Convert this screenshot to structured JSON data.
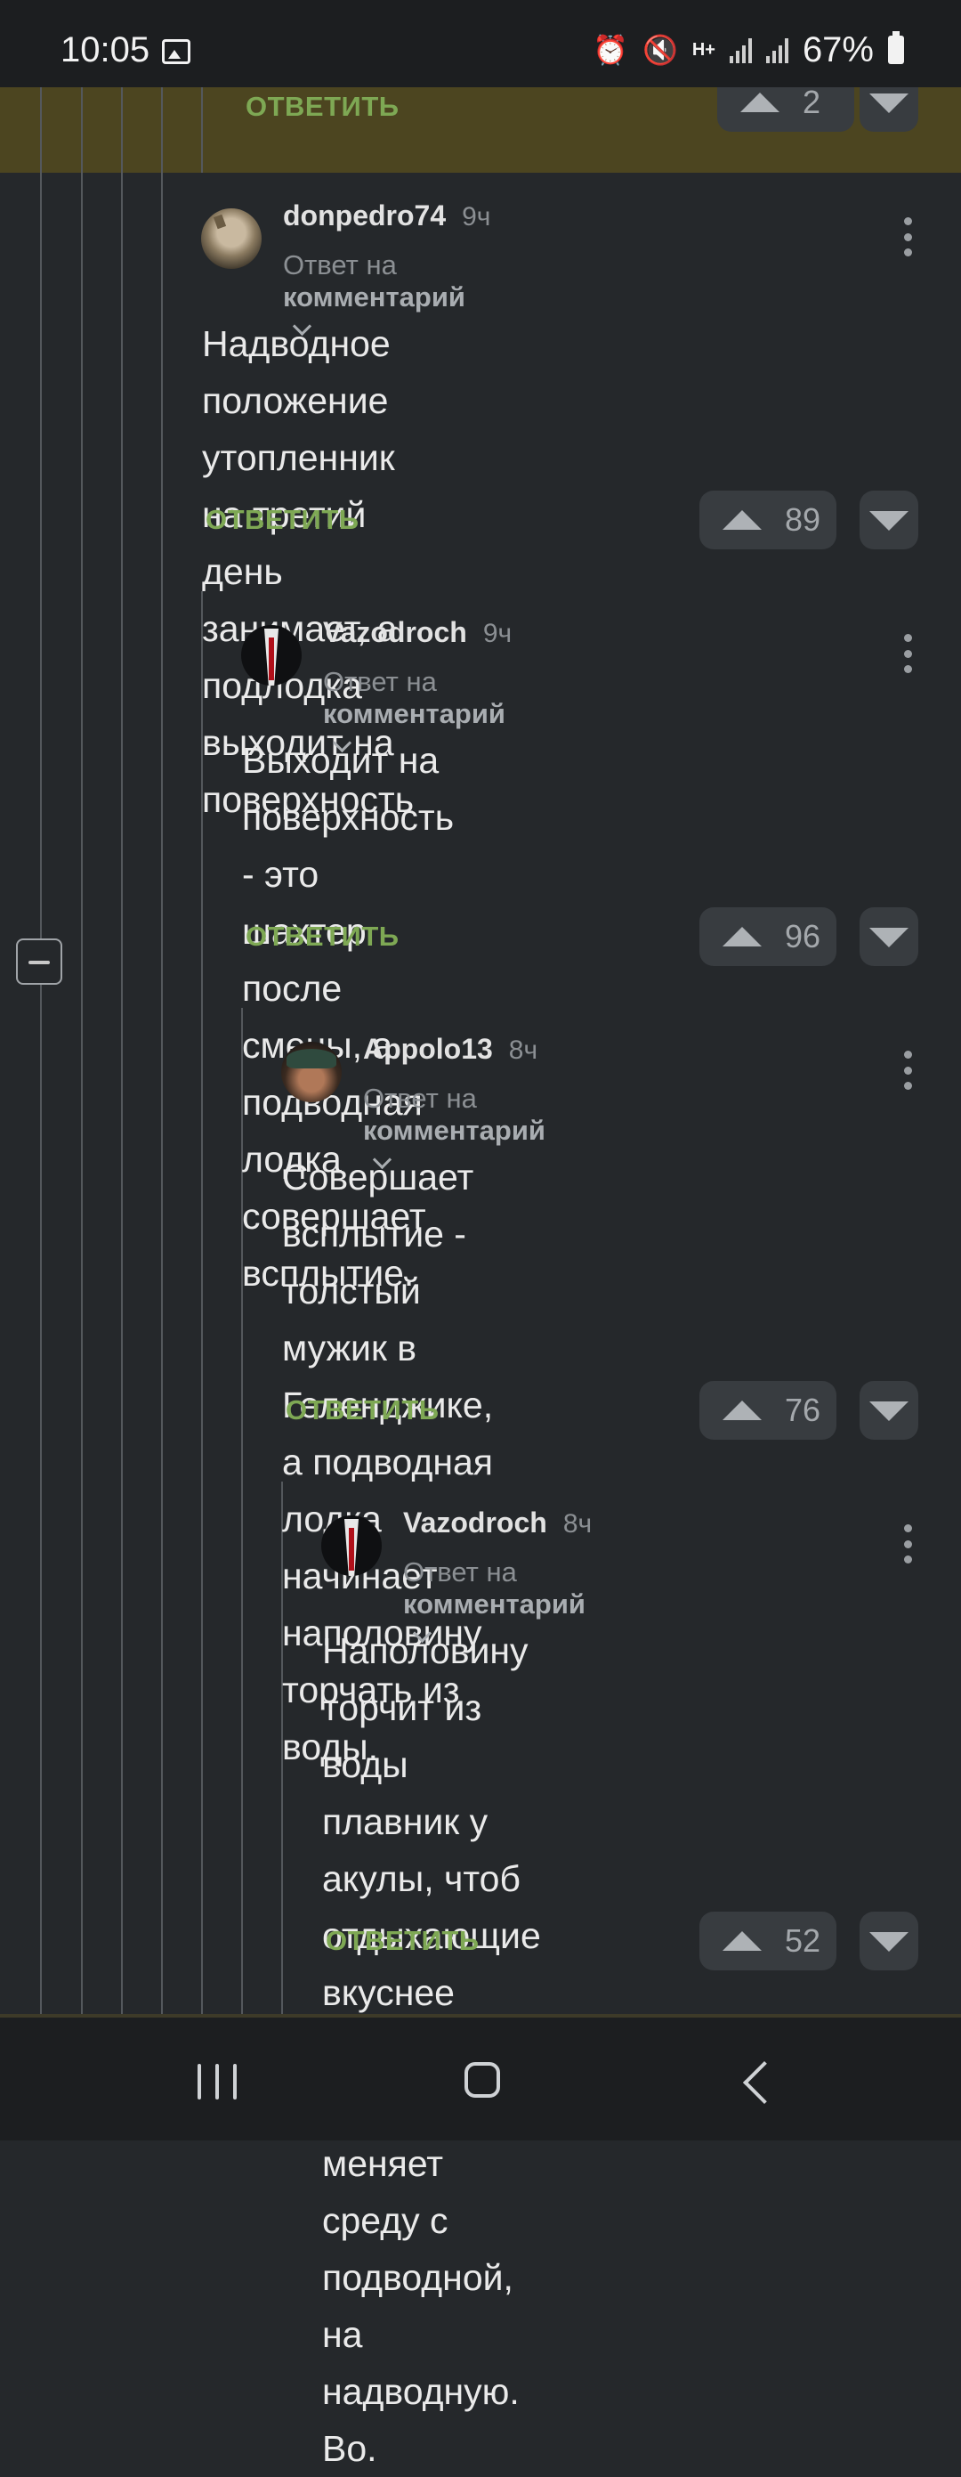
{
  "status_bar": {
    "time": "10:05",
    "battery": "67%",
    "icons": [
      "image-icon",
      "alarm-icon",
      "mute-icon",
      "data-h-plus-icon",
      "signal-icon",
      "signal-icon",
      "battery-icon"
    ]
  },
  "previous_comment": {
    "reply_label": "ОТВЕТИТЬ",
    "votes": "2"
  },
  "comments": [
    {
      "author": "donpedro74",
      "time": "9ч",
      "reply_prefix": "Ответ на",
      "reply_target": "комментарий",
      "lines": [
        "Надводное положение утопленник",
        "на третий день занимает, а подлодка",
        "выходит на поверхность"
      ],
      "reply_label": "ОТВЕТИТЬ",
      "votes": "89"
    },
    {
      "author": "Vazodroch",
      "time": "9ч",
      "reply_prefix": "Ответ на",
      "reply_target": "комментарий",
      "lines": [
        "Выходит на поверхность - это",
        "шахтер после смены, а подводная",
        "лодка совершает всплытие."
      ],
      "reply_label": "ОТВЕТИТЬ",
      "votes": "96"
    },
    {
      "author": "Appolo13",
      "time": "8ч",
      "reply_prefix": "Ответ на",
      "reply_target": "комментарий",
      "lines": [
        "Совершает всплытие -",
        "толстый мужик в Геленджике,",
        "а подводная лодка начинает",
        "наполовину торчать из воды."
      ],
      "reply_label": "ОТВЕТИТЬ",
      "votes": "76"
    },
    {
      "author": "Vazodroch",
      "time": "8ч",
      "reply_prefix": "Ответ на",
      "reply_target": "комментарий",
      "lines": [
        "Наполовину торчит из",
        "воды плавник у акулы, чтоб",
        "отдыхающие вкуснее были,",
        "а подлодка меняет среду с",
        "подводной, на надводную. Во."
      ],
      "reply_label": "ОТВЕТИТЬ",
      "votes": "52"
    }
  ],
  "colors": {
    "background": "#25282b",
    "highlight": "#4c4520",
    "reply_green": "#7ea854"
  }
}
